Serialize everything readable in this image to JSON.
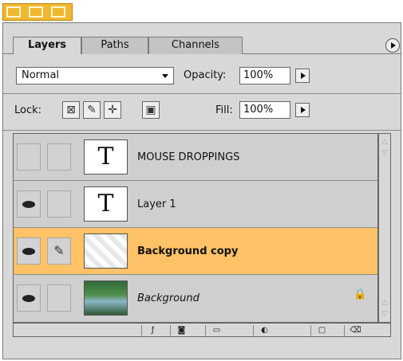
{
  "tabs": [
    {
      "label": "Layers",
      "active": true
    },
    {
      "label": "Paths",
      "active": false
    },
    {
      "label": "Channels",
      "active": false
    }
  ],
  "blend_mode": {
    "value": "Normal"
  },
  "opacity": {
    "label": "Opacity:",
    "value": "100%"
  },
  "lock": {
    "label": "Lock:"
  },
  "fill": {
    "label": "Fill:",
    "value": "100%"
  },
  "layers": [
    {
      "name": "MOUSE DROPPINGS",
      "type": "text",
      "visible": false,
      "thumb_letter": "T"
    },
    {
      "name": "Layer 1",
      "type": "text",
      "visible": true,
      "thumb_letter": "T"
    },
    {
      "name": "Background copy",
      "type": "image",
      "visible": true,
      "selected": true,
      "brush": true
    },
    {
      "name": "Background",
      "type": "image",
      "visible": true,
      "locked": true
    }
  ],
  "colors": {
    "selection": "#ffc266",
    "panel": "#d8d8d8",
    "titlebar": "#f0b830"
  },
  "icons": [
    "lock-transparency-icon",
    "lock-paint-icon",
    "lock-move-icon",
    "lock-all-icon",
    "eye-icon",
    "brush-icon",
    "lock-icon",
    "layer-style-icon",
    "mask-icon",
    "new-set-icon",
    "adjustment-icon",
    "new-layer-icon",
    "trash-icon",
    "palette-menu-icon"
  ]
}
